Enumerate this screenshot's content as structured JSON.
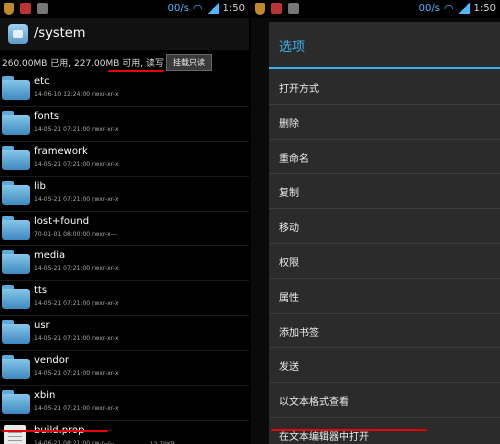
{
  "status_bar": {
    "speed": "00/s",
    "time": "1:50"
  },
  "left": {
    "path": "/system",
    "storage_info": "260.00MB 已用, 227.00MB 可用, 读写",
    "mount_button": "挂载只读",
    "files": [
      {
        "name": "etc",
        "meta": "14-06-10 12:24:00 rwxr-xr-x",
        "type": "folder"
      },
      {
        "name": "fonts",
        "meta": "14-05-21 07:21:00 rwxr-xr-x",
        "type": "folder"
      },
      {
        "name": "framework",
        "meta": "14-05-21 07:21:00 rwxr-xr-x",
        "type": "folder"
      },
      {
        "name": "lib",
        "meta": "14-05-21 07:21:00 rwxr-xr-x",
        "type": "folder"
      },
      {
        "name": "lost+found",
        "meta": "70-01-01 08:00:00 rwxr-x---",
        "type": "folder"
      },
      {
        "name": "media",
        "meta": "14-05-21 07:21:00 rwxr-xr-x",
        "type": "folder"
      },
      {
        "name": "tts",
        "meta": "14-05-21 07:21:00 rwxr-xr-x",
        "type": "folder"
      },
      {
        "name": "usr",
        "meta": "14-05-21 07:21:00 rwxr-xr-x",
        "type": "folder"
      },
      {
        "name": "vendor",
        "meta": "14-05-21 07:21:00 rwxr-xr-x",
        "type": "folder"
      },
      {
        "name": "xbin",
        "meta": "14-05-21 07:21:00 rwxr-xr-x",
        "type": "folder"
      },
      {
        "name": "build.prop",
        "meta": "14-06-21 08:21:00 rw-r--r--",
        "size": "12.79KB",
        "type": "file"
      }
    ]
  },
  "right": {
    "dialog_title": "选项",
    "menu_items": [
      "打开方式",
      "删除",
      "重命名",
      "复制",
      "移动",
      "权限",
      "属性",
      "添加书签",
      "发送",
      "以文本格式查看",
      "在文本编辑器中打开"
    ]
  },
  "colors": {
    "accent": "#39b4f0",
    "annotation_red": "#e60000",
    "folder_blue": "#5ea9d6"
  }
}
